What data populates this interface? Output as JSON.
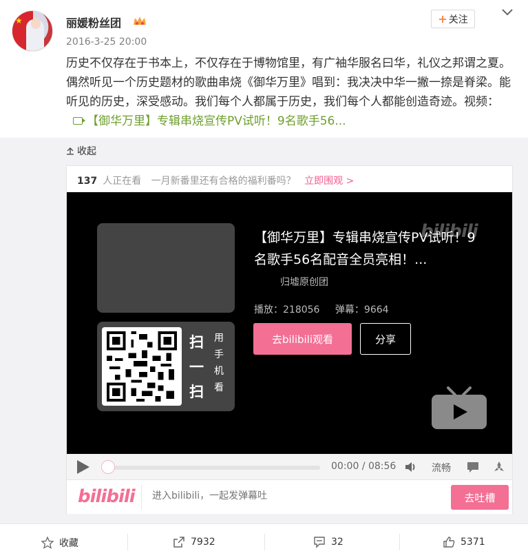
{
  "post": {
    "username": "丽媛粉丝团",
    "time": "2016-3-25 20:00",
    "follow_label": "关注",
    "text_main": "历史不仅存在于书本上，不仅存在于博物馆里，有广袖华服名曰华，礼仪之邦谓之夏。偶然听见一个历史题材的歌曲串烧《御华万里》唱到：我决决中华一撇一捺是脊梁。能听见的历史，深受感动。我们每个人都属于历史，我们每个人都能创造奇迹。视频：",
    "video_link": "【御华万里】专辑串烧宣传PV试听！9名歌手56..."
  },
  "collapse_label": "收起",
  "card": {
    "viewer_count": "137",
    "viewer_text": "人正在看",
    "promo_text": "一月新番里还有合格的福利番吗？",
    "watch_link": "立即围观 >",
    "video_title": "【御华万里】专辑串烧宣传PV试听！9名歌手56名配音全员亮相！...",
    "uploader": "归墟原创团",
    "plays": "播放：218056",
    "danmaku_count": "弹幕：9664",
    "watch_button": "去bilibili观看",
    "share_button": "分享",
    "scan_big": [
      "扫",
      "一",
      "扫"
    ],
    "scan_small": [
      "用",
      "手",
      "机",
      "看"
    ],
    "watermark": "bilibili"
  },
  "player": {
    "timecode": "00:00 / 08:56",
    "quality": "流畅",
    "danmaku_placeholder": "进入bilibili，一起发弹幕吐",
    "send_button": "去吐槽",
    "logo": "bilibili"
  },
  "footer": {
    "favorite": "收藏",
    "repost": "7932",
    "comment": "32",
    "like": "5371"
  },
  "colors": {
    "accent_pink": "#f36f94",
    "link_green": "#6e9f2d",
    "follow_orange": "#ff8140"
  }
}
